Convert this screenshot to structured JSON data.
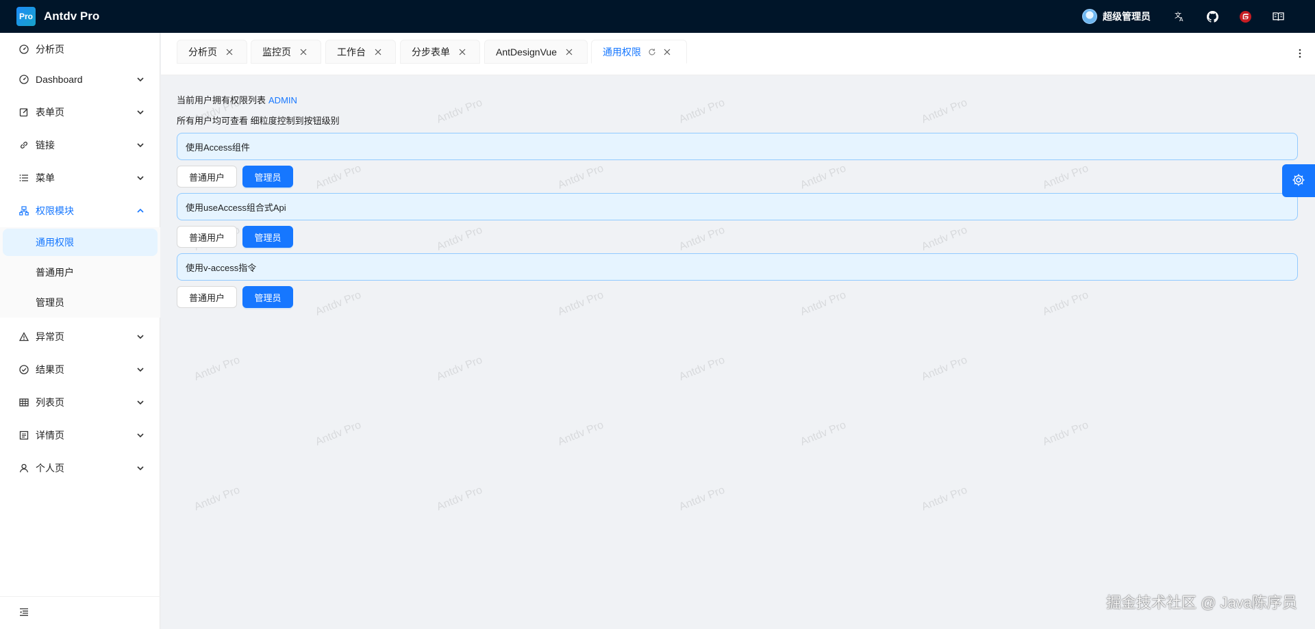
{
  "app": {
    "logo_text": "Pro",
    "title": "Antdv Pro"
  },
  "header": {
    "user_name": "超级管理员",
    "icons": [
      "translate-icon",
      "github-icon",
      "gitee-icon",
      "book-icon"
    ]
  },
  "sidebar": {
    "items": [
      {
        "label": "分析页",
        "icon": "dashboard-icon",
        "has_children": false
      },
      {
        "label": "Dashboard",
        "icon": "dashboard-icon",
        "has_children": true
      },
      {
        "label": "表单页",
        "icon": "form-icon",
        "has_children": true
      },
      {
        "label": "链接",
        "icon": "link-icon",
        "has_children": true
      },
      {
        "label": "菜单",
        "icon": "menu-icon",
        "has_children": true
      },
      {
        "label": "权限模块",
        "icon": "cluster-icon",
        "has_children": true,
        "open": true
      },
      {
        "label": "异常页",
        "icon": "warning-icon",
        "has_children": true
      },
      {
        "label": "结果页",
        "icon": "check-circle-icon",
        "has_children": true
      },
      {
        "label": "列表页",
        "icon": "table-icon",
        "has_children": true
      },
      {
        "label": "详情页",
        "icon": "profile-icon",
        "has_children": true
      },
      {
        "label": "个人页",
        "icon": "user-icon",
        "has_children": true
      }
    ],
    "sub_items": [
      {
        "label": "通用权限",
        "active": true
      },
      {
        "label": "普通用户",
        "active": false
      },
      {
        "label": "管理员",
        "active": false
      }
    ]
  },
  "tabs": [
    {
      "label": "分析页",
      "active": false
    },
    {
      "label": "监控页",
      "active": false
    },
    {
      "label": "工作台",
      "active": false
    },
    {
      "label": "分步表单",
      "active": false
    },
    {
      "label": "AntDesignVue",
      "active": false
    },
    {
      "label": "通用权限",
      "active": true
    }
  ],
  "content": {
    "current_roles_prefix": "当前用户拥有权限列表",
    "current_role": "ADMIN",
    "hint": "所有用户均可查看 细粒度控制到按钮级别",
    "sections": [
      {
        "title": "使用Access组件",
        "buttons": [
          "普通用户",
          "管理员"
        ]
      },
      {
        "title": "使用useAccess组合式Api",
        "buttons": [
          "普通用户",
          "管理员"
        ]
      },
      {
        "title": "使用v-access指令",
        "buttons": [
          "普通用户",
          "管理员"
        ]
      }
    ]
  },
  "watermark_text": "Antdv Pro",
  "corner_watermark": "掘金技术社区 @ Java陈序员",
  "colors": {
    "primary": "#1677ff",
    "header_bg": "#001529",
    "alert_bg": "#e6f4ff",
    "alert_border": "#91caff"
  }
}
